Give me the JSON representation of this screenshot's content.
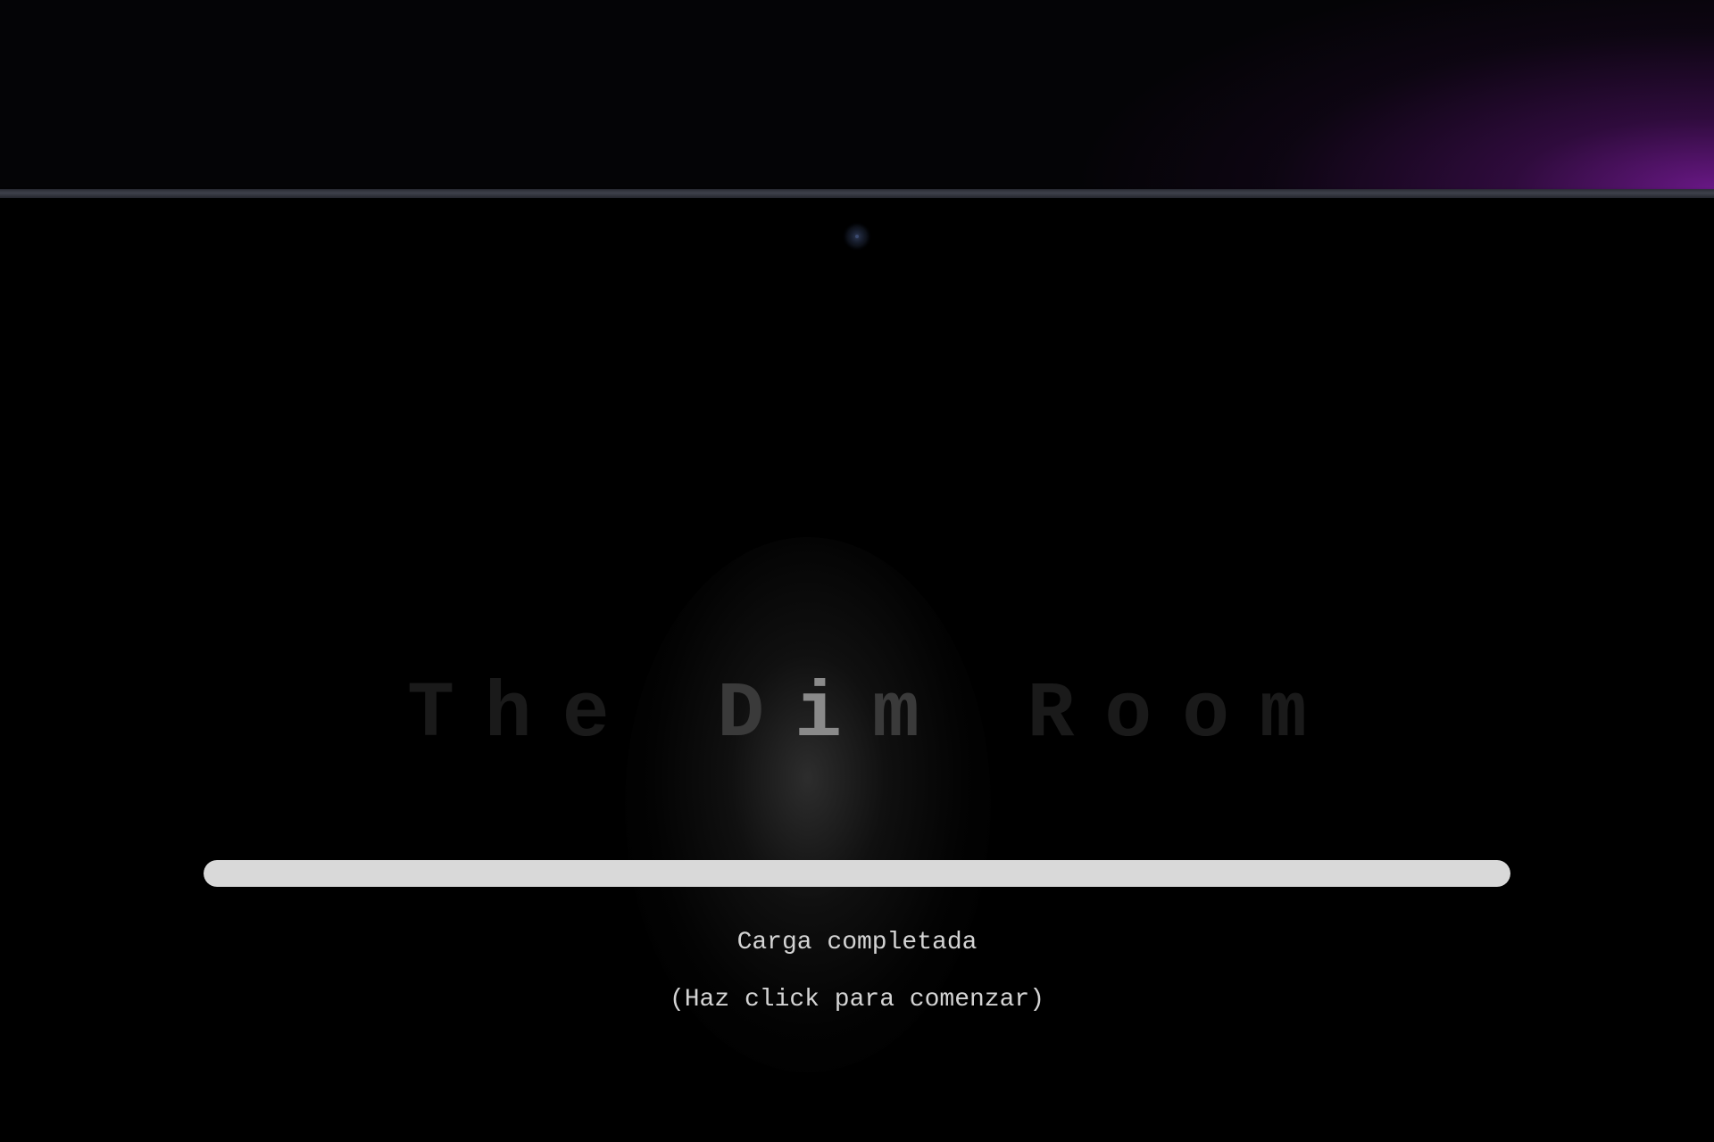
{
  "game": {
    "title": "The Dim Room",
    "title_parts": {
      "the": "The",
      "d": "D",
      "i": "i",
      "m": "m",
      "room": "Room"
    }
  },
  "loader": {
    "progress_fraction": 1.0,
    "status": "Carga completada",
    "hint": "(Haz click para comenzar)"
  },
  "colors": {
    "accent_glow": "#6e198c",
    "progress_fill": "#d9d9d9",
    "text": "#d4d4d4"
  }
}
